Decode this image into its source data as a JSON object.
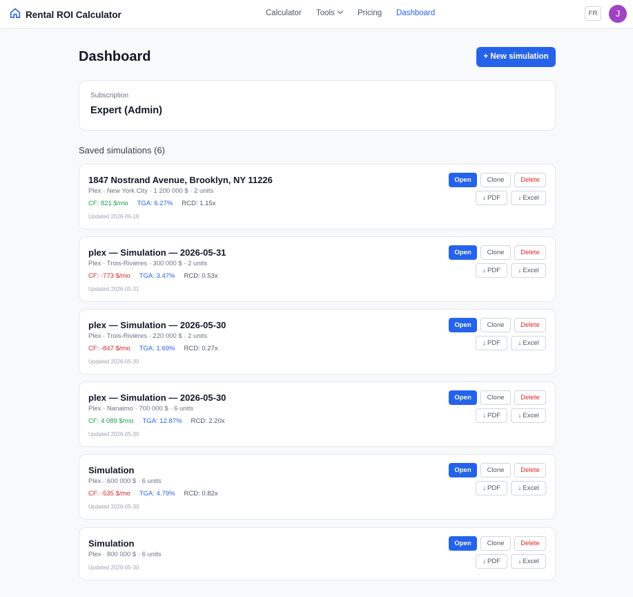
{
  "app": {
    "name": "Rental ROI Calculator"
  },
  "nav": {
    "calculator": "Calculator",
    "tools": "Tools",
    "pricing": "Pricing",
    "dashboard": "Dashboard"
  },
  "header": {
    "lang": "FR",
    "avatar_initial": "J"
  },
  "page": {
    "title": "Dashboard",
    "new_button": "+ New simulation",
    "subscription_label": "Subscription",
    "subscription_value": "Expert (Admin)",
    "saved_title": "Saved simulations (6)"
  },
  "actions": {
    "open": "Open",
    "clone": "Clone",
    "delete": "Delete",
    "pdf": "PDF",
    "excel": "Excel"
  },
  "simulations": [
    {
      "title": "1847 Nostrand Avenue, Brooklyn, NY 11226",
      "meta": "Plex · New York City · 1 200 000 $ · 2 units",
      "cf": "CF: 821 $/mo",
      "tga": "TGA: 6.27%",
      "rcd": "RCD: 1.15x",
      "updated": "Updated 2026-06-16"
    },
    {
      "title": "plex — Simulation — 2026-05-31",
      "meta": "Plex · Trois-Rivières · 300 000 $ · 2 units",
      "cf": "CF: -773 $/mo",
      "tga": "TGA: 3.47%",
      "rcd": "RCD: 0.53x",
      "updated": "Updated 2026-05-31"
    },
    {
      "title": "plex — Simulation — 2026-05-30",
      "meta": "Plex · Trois-Rivières · 220 000 $ · 2 units",
      "cf": "CF: -847 $/mo",
      "tga": "TGA: 1.69%",
      "rcd": "RCD: 0.27x",
      "updated": "Updated 2026-05-30"
    },
    {
      "title": "plex — Simulation — 2026-05-30",
      "meta": "Plex · Nanaimo · 700 000 $ · 6 units",
      "cf": "CF: 4 089 $/mo",
      "tga": "TGA: 12.87%",
      "rcd": "RCD: 2.20x",
      "updated": "Updated 2026-05-30"
    },
    {
      "title": "Simulation",
      "meta": "Plex · 600 000 $ · 6 units",
      "cf": "CF: -535 $/mo",
      "tga": "TGA: 4.79%",
      "rcd": "RCD: 0.82x",
      "updated": "Updated 2026-05-30"
    },
    {
      "title": "Simulation",
      "meta": "Plex · 800 000 $ · 6 units",
      "updated": "Updated 2026-05-30"
    }
  ],
  "colors": {
    "accent": "#2563eb",
    "positive": "#16a34a",
    "negative": "#dc2626",
    "avatar": "#a142c4"
  }
}
